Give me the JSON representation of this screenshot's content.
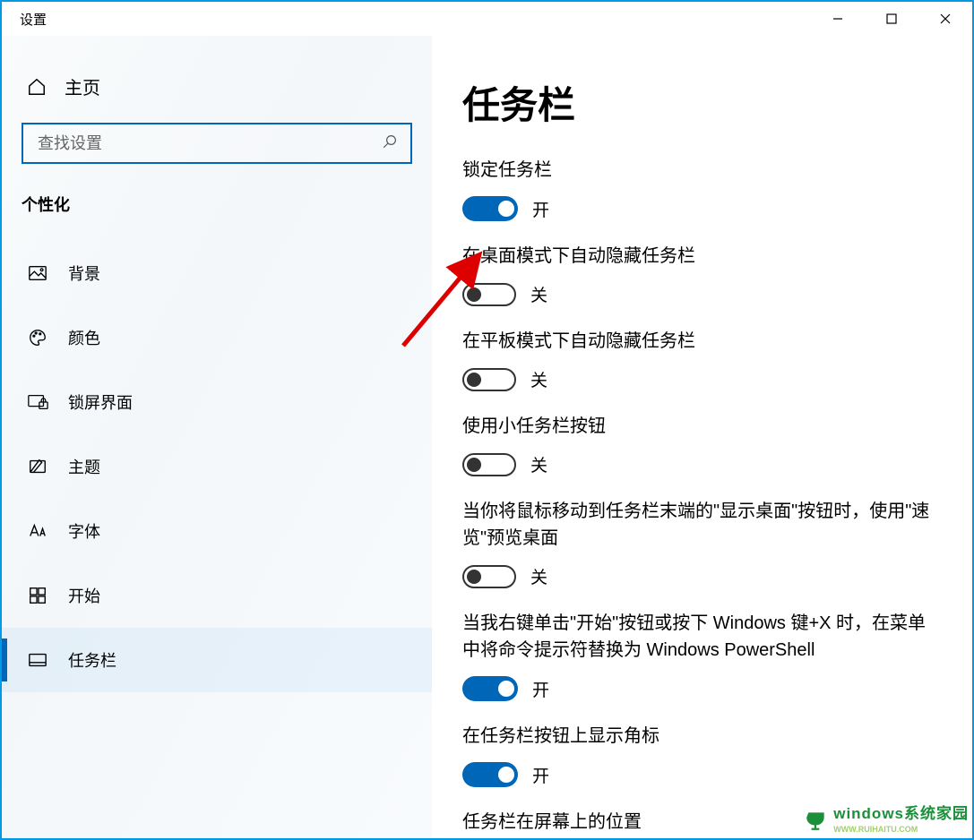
{
  "window": {
    "title": "设置"
  },
  "sidebar": {
    "home": "主页",
    "search_placeholder": "查找设置",
    "section": "个性化",
    "items": [
      {
        "label": "背景"
      },
      {
        "label": "颜色"
      },
      {
        "label": "锁屏界面"
      },
      {
        "label": "主题"
      },
      {
        "label": "字体"
      },
      {
        "label": "开始"
      },
      {
        "label": "任务栏"
      }
    ]
  },
  "main": {
    "heading": "任务栏",
    "settings": [
      {
        "label": "锁定任务栏",
        "on": true,
        "state": "开"
      },
      {
        "label": "在桌面模式下自动隐藏任务栏",
        "on": false,
        "state": "关"
      },
      {
        "label": "在平板模式下自动隐藏任务栏",
        "on": false,
        "state": "关"
      },
      {
        "label": "使用小任务栏按钮",
        "on": false,
        "state": "关"
      },
      {
        "label": "当你将鼠标移动到任务栏末端的\"显示桌面\"按钮时，使用\"速览\"预览桌面",
        "on": false,
        "state": "关"
      },
      {
        "label": "当我右键单击\"开始\"按钮或按下 Windows 键+X 时，在菜单中将命令提示符替换为 Windows PowerShell",
        "on": true,
        "state": "开"
      },
      {
        "label": "在任务栏按钮上显示角标",
        "on": true,
        "state": "开"
      }
    ],
    "trailing_label": "任务栏在屏幕上的位置"
  },
  "watermark": {
    "brand": "windows",
    "sub1": "系统家园",
    "sub2": "WWW.RUIHAITU.COM"
  }
}
